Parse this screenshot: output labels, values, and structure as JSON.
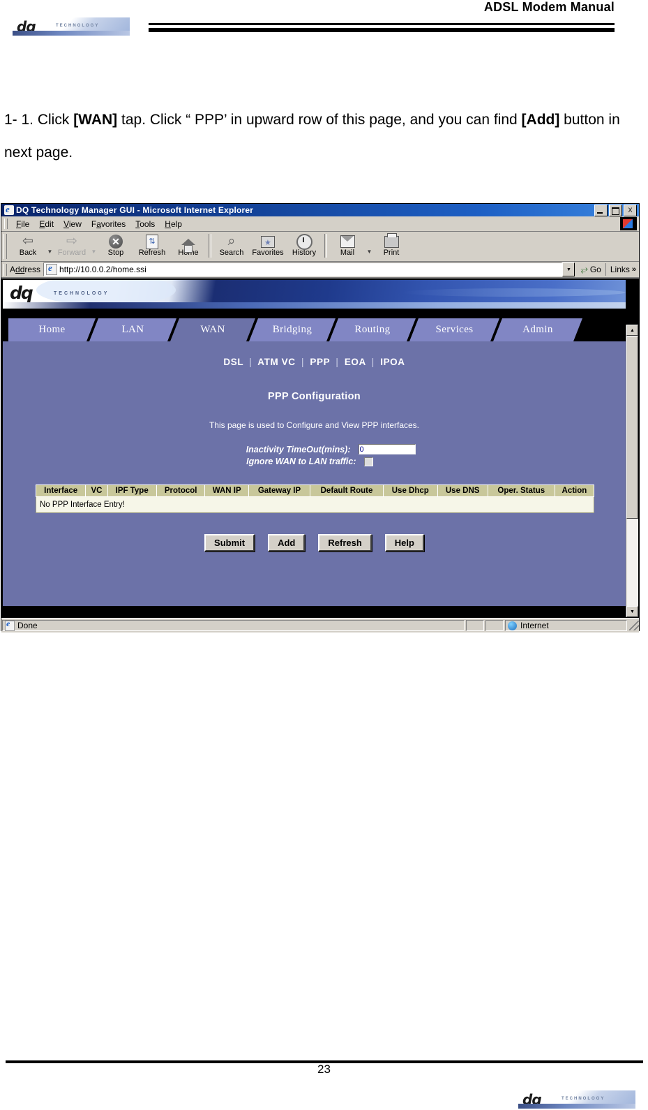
{
  "document": {
    "header_title": "ADSL Modem Manual",
    "logo_text": "dq",
    "logo_subtext": "TECHNOLOGY",
    "page_number": "23",
    "instruction": {
      "prefix": "1- 1. Click ",
      "bold1": "[WAN]",
      "mid1": " tap. Click “ PPP’  in upward row of this page, and you can find ",
      "bold2": "[Add]",
      "mid2": " button in next page."
    }
  },
  "browser": {
    "title": "DQ Technology Manager GUI - Microsoft Internet Explorer",
    "window_controls": {
      "minimize": "_",
      "maximize": "□",
      "close": "X"
    },
    "menu": [
      {
        "label": "File",
        "accel": "F"
      },
      {
        "label": "Edit",
        "accel": "E"
      },
      {
        "label": "View",
        "accel": "V"
      },
      {
        "label": "Favorites",
        "accel": "a"
      },
      {
        "label": "Tools",
        "accel": "T"
      },
      {
        "label": "Help",
        "accel": "H"
      }
    ],
    "toolbar": [
      {
        "label": "Back",
        "icon": "back-arrow-icon",
        "glyph": "⇦",
        "disabled": false,
        "dropdown": true
      },
      {
        "label": "Forward",
        "icon": "forward-arrow-icon",
        "glyph": "⇨",
        "disabled": true,
        "dropdown": true
      },
      {
        "label": "Stop",
        "icon": "stop-icon",
        "glyph": "✕",
        "disabled": false,
        "dropdown": false
      },
      {
        "label": "Refresh",
        "icon": "refresh-icon",
        "glyph": "↻",
        "disabled": false,
        "dropdown": false
      },
      {
        "label": "Home",
        "icon": "home-icon",
        "glyph": "⌂",
        "disabled": false,
        "dropdown": false
      },
      {
        "label": "Search",
        "icon": "search-icon",
        "glyph": "⌕",
        "disabled": false,
        "dropdown": false
      },
      {
        "label": "Favorites",
        "icon": "favorites-folder-icon",
        "glyph": "★",
        "disabled": false,
        "dropdown": false
      },
      {
        "label": "History",
        "icon": "history-clock-icon",
        "glyph": "◷",
        "disabled": false,
        "dropdown": false
      },
      {
        "label": "Mail",
        "icon": "mail-icon",
        "glyph": "✉",
        "disabled": false,
        "dropdown": true
      },
      {
        "label": "Print",
        "icon": "printer-icon",
        "glyph": "⎙",
        "disabled": false,
        "dropdown": false
      }
    ],
    "address": {
      "label": "Address",
      "url": "http://10.0.0.2/home.ssi",
      "go_label": "Go",
      "links_label": "Links",
      "links_chevron": "»",
      "dropdown_glyph": "▼"
    },
    "statusbar": {
      "text": "Done",
      "zone": "Internet"
    }
  },
  "webpage": {
    "brand": {
      "logo_text": "dq",
      "logo_subtext": "TECHNOLOGY"
    },
    "tabs": [
      {
        "label": "Home",
        "active": false
      },
      {
        "label": "LAN",
        "active": false
      },
      {
        "label": "WAN",
        "active": true
      },
      {
        "label": "Bridging",
        "active": false
      },
      {
        "label": "Routing",
        "active": false
      },
      {
        "label": "Services",
        "active": false
      },
      {
        "label": "Admin",
        "active": false
      }
    ],
    "subnav": [
      {
        "label": "DSL"
      },
      {
        "label": "ATM VC"
      },
      {
        "label": "PPP"
      },
      {
        "label": "EOA"
      },
      {
        "label": "IPOA"
      }
    ],
    "subnav_separator": "|",
    "title": "PPP Configuration",
    "description": "This page is used to Configure and View PPP interfaces.",
    "form": {
      "inactivity_timeout_label": "Inactivity TimeOut(mins):",
      "inactivity_timeout_value": "0",
      "ignore_wan_to_lan_label": "Ignore WAN to LAN traffic:",
      "ignore_wan_to_lan_checked": false
    },
    "table": {
      "headers": [
        "Interface",
        "VC",
        "IPF Type",
        "Protocol",
        "WAN IP",
        "Gateway IP",
        "Default Route",
        "Use Dhcp",
        "Use DNS",
        "Oper. Status",
        "Action"
      ],
      "empty_message": "No PPP Interface Entry!"
    },
    "buttons": [
      {
        "label": "Submit"
      },
      {
        "label": "Add"
      },
      {
        "label": "Refresh"
      },
      {
        "label": "Help"
      }
    ],
    "colors": {
      "page_background": "#6c72a8",
      "tab_inactive": "#8186c4",
      "tab_active": "#6c72a8",
      "table_header": "#c8c79a",
      "table_body": "#f6f6e8",
      "text_on_page": "#ffffff"
    }
  }
}
